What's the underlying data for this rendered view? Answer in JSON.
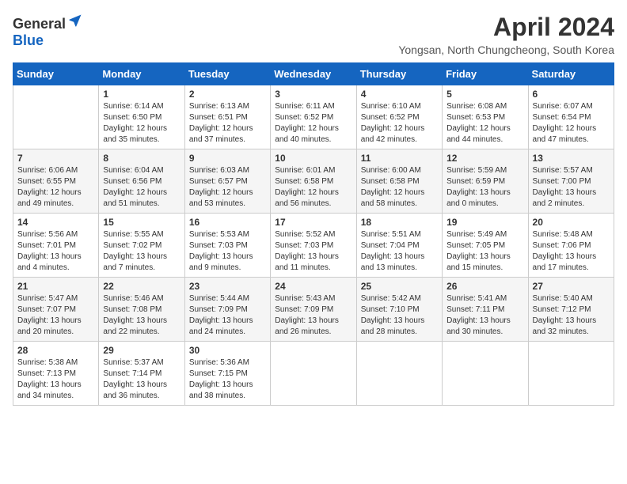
{
  "header": {
    "logo": {
      "general": "General",
      "blue": "Blue"
    },
    "title": "April 2024",
    "location": "Yongsan, North Chungcheong, South Korea"
  },
  "calendar": {
    "days_of_week": [
      "Sunday",
      "Monday",
      "Tuesday",
      "Wednesday",
      "Thursday",
      "Friday",
      "Saturday"
    ],
    "weeks": [
      [
        {
          "day": "",
          "info": ""
        },
        {
          "day": "1",
          "info": "Sunrise: 6:14 AM\nSunset: 6:50 PM\nDaylight: 12 hours\nand 35 minutes."
        },
        {
          "day": "2",
          "info": "Sunrise: 6:13 AM\nSunset: 6:51 PM\nDaylight: 12 hours\nand 37 minutes."
        },
        {
          "day": "3",
          "info": "Sunrise: 6:11 AM\nSunset: 6:52 PM\nDaylight: 12 hours\nand 40 minutes."
        },
        {
          "day": "4",
          "info": "Sunrise: 6:10 AM\nSunset: 6:52 PM\nDaylight: 12 hours\nand 42 minutes."
        },
        {
          "day": "5",
          "info": "Sunrise: 6:08 AM\nSunset: 6:53 PM\nDaylight: 12 hours\nand 44 minutes."
        },
        {
          "day": "6",
          "info": "Sunrise: 6:07 AM\nSunset: 6:54 PM\nDaylight: 12 hours\nand 47 minutes."
        }
      ],
      [
        {
          "day": "7",
          "info": "Sunrise: 6:06 AM\nSunset: 6:55 PM\nDaylight: 12 hours\nand 49 minutes."
        },
        {
          "day": "8",
          "info": "Sunrise: 6:04 AM\nSunset: 6:56 PM\nDaylight: 12 hours\nand 51 minutes."
        },
        {
          "day": "9",
          "info": "Sunrise: 6:03 AM\nSunset: 6:57 PM\nDaylight: 12 hours\nand 53 minutes."
        },
        {
          "day": "10",
          "info": "Sunrise: 6:01 AM\nSunset: 6:58 PM\nDaylight: 12 hours\nand 56 minutes."
        },
        {
          "day": "11",
          "info": "Sunrise: 6:00 AM\nSunset: 6:58 PM\nDaylight: 12 hours\nand 58 minutes."
        },
        {
          "day": "12",
          "info": "Sunrise: 5:59 AM\nSunset: 6:59 PM\nDaylight: 13 hours\nand 0 minutes."
        },
        {
          "day": "13",
          "info": "Sunrise: 5:57 AM\nSunset: 7:00 PM\nDaylight: 13 hours\nand 2 minutes."
        }
      ],
      [
        {
          "day": "14",
          "info": "Sunrise: 5:56 AM\nSunset: 7:01 PM\nDaylight: 13 hours\nand 4 minutes."
        },
        {
          "day": "15",
          "info": "Sunrise: 5:55 AM\nSunset: 7:02 PM\nDaylight: 13 hours\nand 7 minutes."
        },
        {
          "day": "16",
          "info": "Sunrise: 5:53 AM\nSunset: 7:03 PM\nDaylight: 13 hours\nand 9 minutes."
        },
        {
          "day": "17",
          "info": "Sunrise: 5:52 AM\nSunset: 7:03 PM\nDaylight: 13 hours\nand 11 minutes."
        },
        {
          "day": "18",
          "info": "Sunrise: 5:51 AM\nSunset: 7:04 PM\nDaylight: 13 hours\nand 13 minutes."
        },
        {
          "day": "19",
          "info": "Sunrise: 5:49 AM\nSunset: 7:05 PM\nDaylight: 13 hours\nand 15 minutes."
        },
        {
          "day": "20",
          "info": "Sunrise: 5:48 AM\nSunset: 7:06 PM\nDaylight: 13 hours\nand 17 minutes."
        }
      ],
      [
        {
          "day": "21",
          "info": "Sunrise: 5:47 AM\nSunset: 7:07 PM\nDaylight: 13 hours\nand 20 minutes."
        },
        {
          "day": "22",
          "info": "Sunrise: 5:46 AM\nSunset: 7:08 PM\nDaylight: 13 hours\nand 22 minutes."
        },
        {
          "day": "23",
          "info": "Sunrise: 5:44 AM\nSunset: 7:09 PM\nDaylight: 13 hours\nand 24 minutes."
        },
        {
          "day": "24",
          "info": "Sunrise: 5:43 AM\nSunset: 7:09 PM\nDaylight: 13 hours\nand 26 minutes."
        },
        {
          "day": "25",
          "info": "Sunrise: 5:42 AM\nSunset: 7:10 PM\nDaylight: 13 hours\nand 28 minutes."
        },
        {
          "day": "26",
          "info": "Sunrise: 5:41 AM\nSunset: 7:11 PM\nDaylight: 13 hours\nand 30 minutes."
        },
        {
          "day": "27",
          "info": "Sunrise: 5:40 AM\nSunset: 7:12 PM\nDaylight: 13 hours\nand 32 minutes."
        }
      ],
      [
        {
          "day": "28",
          "info": "Sunrise: 5:38 AM\nSunset: 7:13 PM\nDaylight: 13 hours\nand 34 minutes."
        },
        {
          "day": "29",
          "info": "Sunrise: 5:37 AM\nSunset: 7:14 PM\nDaylight: 13 hours\nand 36 minutes."
        },
        {
          "day": "30",
          "info": "Sunrise: 5:36 AM\nSunset: 7:15 PM\nDaylight: 13 hours\nand 38 minutes."
        },
        {
          "day": "",
          "info": ""
        },
        {
          "day": "",
          "info": ""
        },
        {
          "day": "",
          "info": ""
        },
        {
          "day": "",
          "info": ""
        }
      ]
    ]
  }
}
